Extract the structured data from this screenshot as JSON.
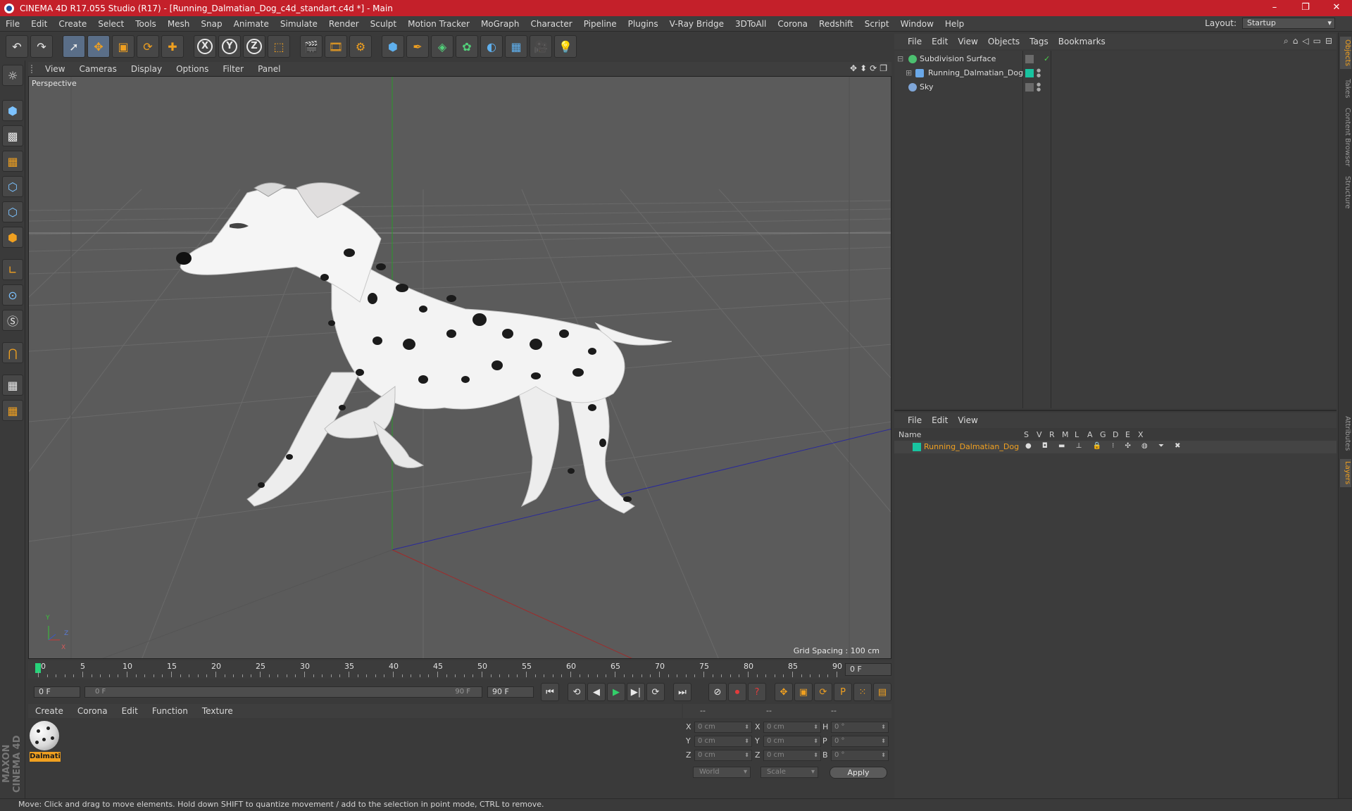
{
  "window": {
    "title": "CINEMA 4D R17.055 Studio (R17) - [Running_Dalmatian_Dog_c4d_standart.c4d *] - Main",
    "controls": [
      "–",
      "❐",
      "✕"
    ]
  },
  "menu": [
    "File",
    "Edit",
    "Create",
    "Select",
    "Tools",
    "Mesh",
    "Snap",
    "Animate",
    "Simulate",
    "Render",
    "Sculpt",
    "Motion Tracker",
    "MoGraph",
    "Character",
    "Pipeline",
    "Plugins",
    "V-Ray Bridge",
    "3DToAll",
    "Corona",
    "Redshift",
    "Script",
    "Window",
    "Help"
  ],
  "layout": {
    "label": "Layout:",
    "value": "Startup"
  },
  "toolbar": {
    "undo": "↶",
    "redo": "↷",
    "select": "➚",
    "move": "✥",
    "scale": "▣",
    "rotate": "⟳",
    "add": "✚",
    "x": "X",
    "y": "Y",
    "z": "Z",
    "coord": "⬚",
    "render_view": "🎬",
    "render_pic": "🎞",
    "render_settings": "⚙",
    "cube": "⬢",
    "pen": "✒",
    "subdiv": "◈",
    "array": "✿",
    "deform": "◐",
    "floor": "▦",
    "camera": "🎥",
    "light": "💡"
  },
  "viewport": {
    "menu": [
      "View",
      "Cameras",
      "Display",
      "Options",
      "Filter",
      "Panel"
    ],
    "nav_icons": [
      "✥",
      "⬍",
      "⟳",
      "❐"
    ],
    "label": "Perspective",
    "grid_spacing": "Grid Spacing : 100 cm",
    "axis_y": "Y",
    "axis_z": "Z",
    "axis_x": "X"
  },
  "timeline": {
    "ticks": [
      "0",
      "5",
      "10",
      "15",
      "20",
      "25",
      "30",
      "35",
      "40",
      "45",
      "50",
      "55",
      "60",
      "65",
      "70",
      "75",
      "80",
      "85",
      "90"
    ],
    "current_frame": "0 F",
    "start_field": "0 F",
    "slider_start": "0 F",
    "slider_end": "90 F",
    "end_field": "90 F"
  },
  "transport": {
    "first": "⏮",
    "prev_key": "⟲",
    "prev": "◀",
    "play": "▶",
    "next": "▶|",
    "next_key": "⟳",
    "last": "⏭",
    "record_pos": "⊘",
    "record": "⏺",
    "help": "?",
    "key_move": "✥",
    "key_scale": "▣",
    "key_rot": "⟳",
    "key_p": "P",
    "key_grid": "⁙",
    "film": "▤"
  },
  "materials": {
    "menu": [
      "Create",
      "Corona",
      "Edit",
      "Function",
      "Texture"
    ],
    "items": [
      {
        "name": "Dalmati"
      }
    ]
  },
  "coordinates": {
    "header": [
      "--",
      "--",
      "--"
    ],
    "rows": [
      {
        "pos_label": "X",
        "pos_value": "0 cm",
        "size_label": "X",
        "size_value": "0 cm",
        "rot_label": "H",
        "rot_value": "0 °"
      },
      {
        "pos_label": "Y",
        "pos_value": "0 cm",
        "size_label": "Y",
        "size_value": "0 cm",
        "rot_label": "P",
        "rot_value": "0 °"
      },
      {
        "pos_label": "Z",
        "pos_value": "0 cm",
        "size_label": "Z",
        "size_value": "0 cm",
        "rot_label": "B",
        "rot_value": "0 °"
      }
    ],
    "space": "World",
    "mode": "Scale",
    "apply": "Apply"
  },
  "status": "Move: Click and drag to move elements. Hold down SHIFT to quantize movement / add to the selection in point mode, CTRL to remove.",
  "objects": {
    "menu": [
      "File",
      "Edit",
      "View",
      "Objects",
      "Tags",
      "Bookmarks"
    ],
    "tools": [
      "⌕",
      "⌂",
      "◁",
      "▭",
      "⊟"
    ],
    "items": [
      {
        "name": "Subdivision Surface",
        "check": "✓"
      },
      {
        "name": "Running_Dalmatian_Dog"
      },
      {
        "name": "Sky"
      }
    ]
  },
  "layers": {
    "menu": [
      "File",
      "Edit",
      "View"
    ],
    "columns": [
      "Name",
      "S",
      "V",
      "R",
      "M",
      "L",
      "A",
      "G",
      "D",
      "E",
      "X"
    ],
    "items": [
      {
        "name": "Running_Dalmatian_Dog",
        "icons": "● ◘ ▬ ⊥ 🔒 ⁝ ✣ ◍ ⏷ ✖"
      }
    ],
    "color": "#18c4a0"
  },
  "side_tabs": [
    "Objects",
    "Takes",
    "Content Browser",
    "Structure",
    "Attributes",
    "Layers"
  ],
  "colors": {
    "accent": "#f0a020",
    "titlebar": "#c4202a",
    "viewport": "#5b5b5b"
  }
}
